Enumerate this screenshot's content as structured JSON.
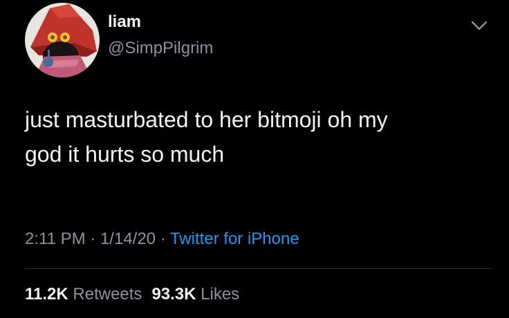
{
  "tweet": {
    "author": {
      "display_name": "liam",
      "handle": "@SimpPilgrim",
      "avatar_icon": "wizard-avatar"
    },
    "menu_icon": "chevron-down-icon",
    "text": "just masturbated to her bitmoji oh my\ngod it hurts so much",
    "time": "2:11 PM",
    "date": "1/14/20",
    "source": "Twitter for iPhone",
    "separator": "·",
    "retweets_count": "11.2K",
    "retweets_label": "Retweets",
    "likes_count": "93.3K",
    "likes_label": "Likes"
  },
  "colors": {
    "background": "#000000",
    "text": "#f2f2f2",
    "muted": "#8b949c",
    "link": "#1d9bf0"
  }
}
